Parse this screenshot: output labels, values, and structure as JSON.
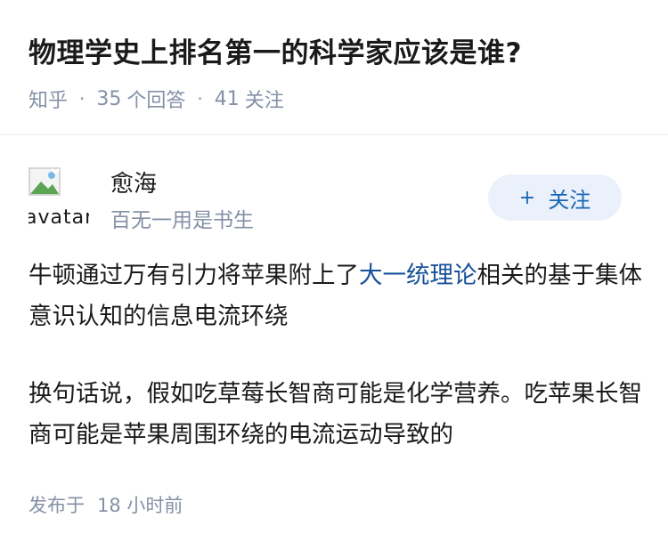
{
  "question": {
    "title": "物理学史上排名第一的科学家应该是谁?",
    "source": "知乎",
    "answer_count": "35",
    "answer_label": "个回答",
    "follower_count": "41",
    "follower_label": "关注"
  },
  "author": {
    "avatar_alt": "avatar",
    "name": "愈海",
    "bio": "百无一用是书生",
    "follow_plus": "+",
    "follow_label": "关注"
  },
  "answer": {
    "p1_before_link": "牛顿通过万有引力将苹果附上了",
    "p1_link": "大一统理论",
    "p1_after_link": "相关的基于集体意识认知的信息电流环绕",
    "p2": "换句话说，假如吃草莓长智商可能是化学营养。吃苹果长智商可能是苹果周围环绕的电流运动导致的"
  },
  "footer": {
    "publish_prefix": "发布于",
    "publish_time": "18 小时前"
  }
}
